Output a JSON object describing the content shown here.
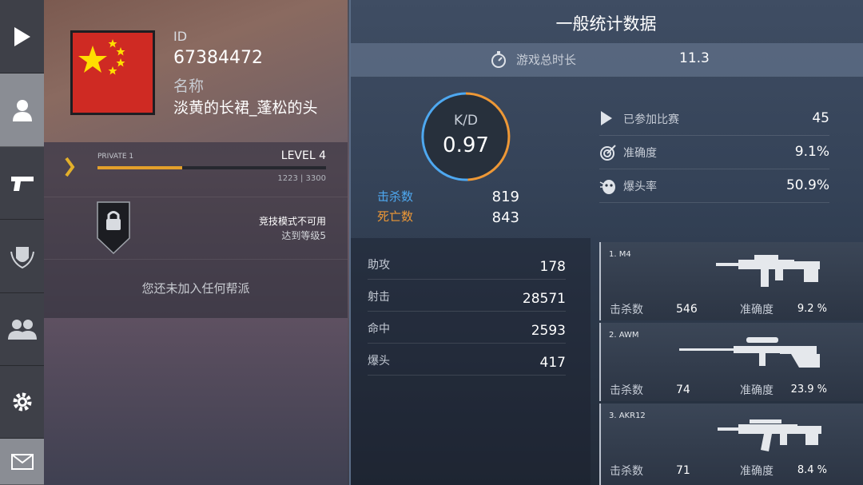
{
  "nav": {
    "items": [
      {
        "icon": "play-icon"
      },
      {
        "icon": "profile-icon"
      },
      {
        "icon": "pistol-icon"
      },
      {
        "icon": "clan-emblem-icon"
      },
      {
        "icon": "friends-icon"
      },
      {
        "icon": "gear-icon"
      },
      {
        "icon": "mail-icon"
      }
    ],
    "active_index": 1
  },
  "profile": {
    "id_label": "ID",
    "id_value": "67384472",
    "name_label": "名称",
    "name_value": "淡黄的长裙_蓬松的头",
    "flag": "china-flag"
  },
  "rank": {
    "name": "PRIVATE 1",
    "level": "LEVEL 4",
    "xp_text": "1223 | 3300",
    "xp_current": 1223,
    "xp_total": 3300
  },
  "competitive": {
    "line1": "竞技模式不可用",
    "line2": "达到等级5"
  },
  "clan": {
    "text": "您还未加入任何帮派"
  },
  "stats": {
    "title": "一般统计数据",
    "playtime_label": "游戏总时长",
    "playtime_value": "11.3",
    "kd_label": "K/D",
    "kd_value": "0.97",
    "kills_label": "击杀数",
    "kills_value": "819",
    "deaths_label": "死亡数",
    "deaths_value": "843",
    "right_rows": [
      {
        "icon": "play-icon",
        "label": "已参加比赛",
        "value": "45"
      },
      {
        "icon": "target-icon",
        "label": "准确度",
        "value": "9.1%"
      },
      {
        "icon": "headshot-icon",
        "label": "爆头率",
        "value": "50.9%"
      }
    ],
    "misc_rows": [
      {
        "label": "助攻",
        "value": "178"
      },
      {
        "label": "射击",
        "value": "28571"
      },
      {
        "label": "命中",
        "value": "2593"
      },
      {
        "label": "爆头",
        "value": "417"
      }
    ]
  },
  "weapons": [
    {
      "name": "1. M4",
      "kills_label": "击杀数",
      "kills": "546",
      "accuracy_label": "准确度",
      "accuracy": "9.2 %"
    },
    {
      "name": "2. AWM",
      "kills_label": "击杀数",
      "kills": "74",
      "accuracy_label": "准确度",
      "accuracy": "23.9 %"
    },
    {
      "name": "3. AKR12",
      "kills_label": "击杀数",
      "kills": "71",
      "accuracy_label": "准确度",
      "accuracy": "8.4 %"
    }
  ],
  "colors": {
    "kills": "#4ea8f0",
    "deaths": "#ee9836",
    "xp_bar": "#e3a02b",
    "flag_red": "#cf2a23",
    "flag_star": "#ffde00"
  }
}
